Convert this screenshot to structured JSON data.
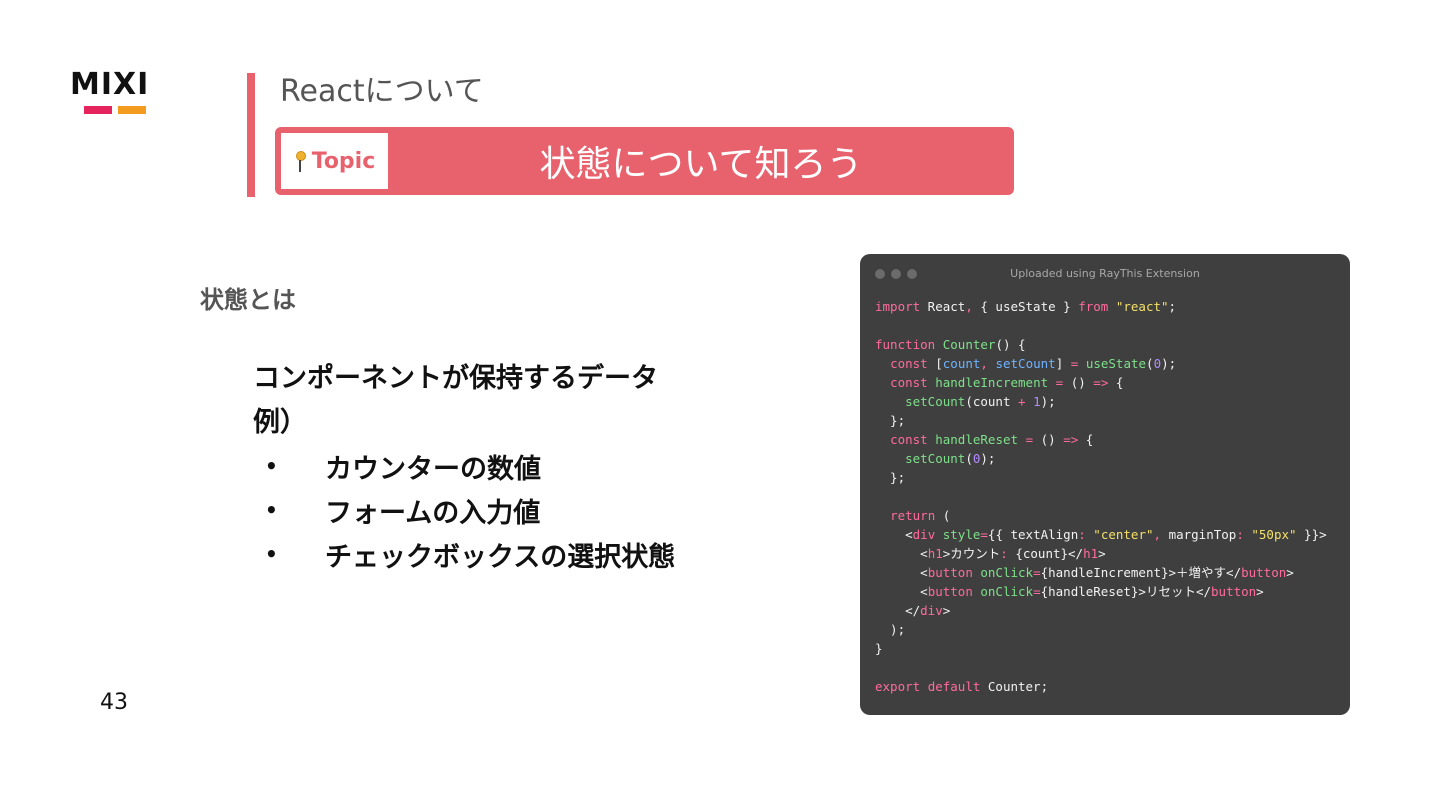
{
  "logo": {
    "text": "MIXI",
    "bar_colors": [
      "#e5245e",
      "#f39c1f"
    ]
  },
  "header": {
    "section_title": "Reactについて",
    "topic_tag": "Topic",
    "topic_title": "状態について知ろう",
    "accent_color": "#e8626e"
  },
  "content": {
    "heading": "状態とは",
    "definition": "コンポーネントが保持するデータ",
    "example_label": "例）",
    "bullet_symbol": "•",
    "bullets": [
      "カウンターの数値",
      "フォームの入力値",
      "チェックボックスの選択状態"
    ]
  },
  "code_window": {
    "caption": "Uploaded using RayThis Extension",
    "lines": [
      "import React, { useState } from \"react\";",
      "",
      "function Counter() {",
      "  const [count, setCount] = useState(0);",
      "  const handleIncrement = () => {",
      "    setCount(count + 1);",
      "  };",
      "  const handleReset = () => {",
      "    setCount(0);",
      "  };",
      "",
      "  return (",
      "    <div style={{ textAlign: \"center\", marginTop: \"50px\" }}>",
      "      <h1>カウント: {count}</h1>",
      "      <button onClick={handleIncrement}>＋増やす</button>",
      "      <button onClick={handleReset}>リセット</button>",
      "    </div>",
      "  );",
      "}",
      "",
      "export default Counter;"
    ]
  },
  "page_number": "43"
}
